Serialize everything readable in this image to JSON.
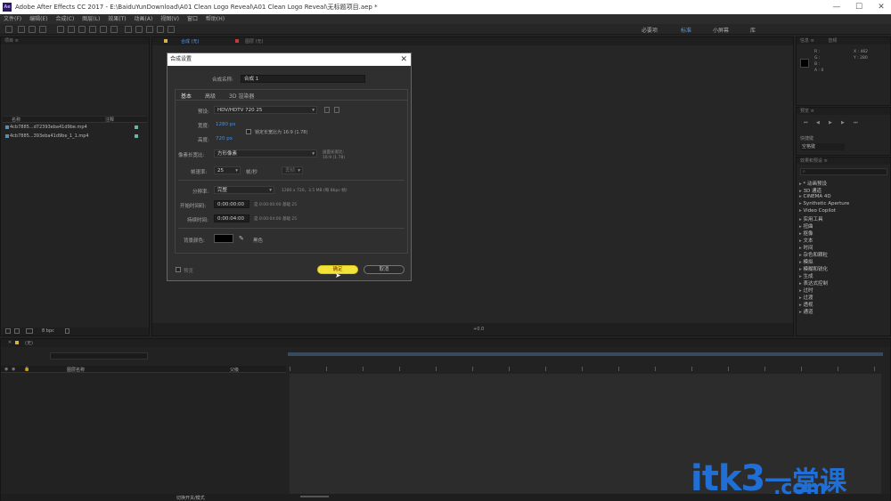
{
  "window": {
    "app_icon": "Ae",
    "title": "Adobe After Effects CC 2017 - E:\\BaiduYunDownload\\A01 Clean Logo Reveal\\A01 Clean Logo Reveal\\无标题项目.aep *",
    "minimize": "—",
    "maximize": "☐",
    "close": "✕"
  },
  "menu": [
    "文件(F)",
    "编辑(E)",
    "合成(C)",
    "图层(L)",
    "效果(T)",
    "动画(A)",
    "视图(V)",
    "窗口",
    "帮助(H)"
  ],
  "workspaces": [
    "必要项",
    "标准",
    "小屏幕",
    "库"
  ],
  "project": {
    "panel_title": "项目 ≡",
    "col_name": "名称",
    "col_comment": "注释",
    "items": [
      "4cb7885...d72393eba41d9be.mp4",
      "4cb7885...393eba41d9be_1_1.mp4"
    ],
    "bpc": "8 bpc"
  },
  "comp_viewer": {
    "tab_comp": "合成 (无)",
    "tab_layer": "图层 (无)",
    "zoom": "+0.0"
  },
  "info_panel": {
    "tabs": [
      "信息 ≡",
      "音频"
    ],
    "r": "R :",
    "g": "G :",
    "b": "B :",
    "a": "A : 0",
    "x": "X : 462",
    "y": "Y : 280"
  },
  "preview_panel": {
    "title": "预览 ≡",
    "shortcut_label": "快捷键",
    "shortcut_value": "空格键"
  },
  "effects_panel": {
    "title": "效果和预设 ≡",
    "search_placeholder": "",
    "items": [
      "* 动画预设",
      "3D 通道",
      "CINEMA 4D",
      "Synthetic Aperture",
      "Video Copilot",
      "实用工具",
      "扭曲",
      "抠像",
      "文本",
      "时间",
      "杂色和颗粒",
      "模拟",
      "模糊和锐化",
      "生成",
      "表达式控制",
      "过时",
      "过渡",
      "透视",
      "通道"
    ]
  },
  "timeline": {
    "tab": "(无)",
    "col_layer_name": "图层名称",
    "col_parent": "父级",
    "footer_toggle": "切换开关/模式"
  },
  "dialog": {
    "title": "合成设置",
    "close": "✕",
    "name_label": "合成名称:",
    "name_value": "合成 1",
    "tabs": [
      "基本",
      "高级",
      "3D 渲染器"
    ],
    "preset_label": "预设:",
    "preset_value": "HDV/HDTV 720 25",
    "width_label": "宽度:",
    "width_value": "1280 px",
    "height_label": "高度:",
    "height_value": "720 px",
    "lock_ratio_label": "锁定长宽比为 16:9 (1.78)",
    "par_label": "像素长宽比:",
    "par_value": "方形像素",
    "frame_ratio_label": "画面长宽比:",
    "frame_ratio_value": "16:9 (1.78)",
    "fps_label": "帧速率:",
    "fps_value": "25",
    "fps_unit": "帧/秒",
    "fps_drop": "丢帧",
    "resolution_label": "分辨率:",
    "resolution_value": "完整",
    "resolution_info": "1280 x 720，3.5 MB (每 8bpc 帧)",
    "start_tc_label": "开始时间码:",
    "start_tc_value": "0:00:00:00",
    "start_tc_info": "是 0:00:00:00  基础 25",
    "duration_label": "持续时间:",
    "duration_value": "0:00:04:00",
    "duration_info": "是 0:00:04:00  基础 25",
    "bg_label": "背景颜色:",
    "bg_name": "黑色",
    "preview_label": "预览",
    "ok_label": "确定",
    "cancel_label": "取消",
    "colors": {
      "ok_fill": "#f2e23a",
      "border": "#6f6a3c"
    }
  },
  "watermark": {
    "latin": "itk3",
    "cn": "一堂课",
    "com": ".com",
    "color": "#1f6fd6"
  }
}
